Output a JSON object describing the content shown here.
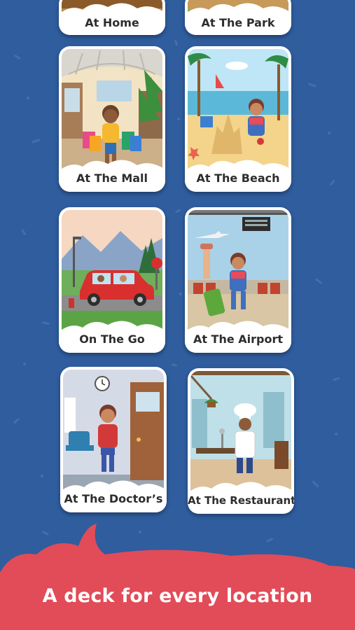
{
  "colors": {
    "background": "#2f5d9e",
    "footer": "#e24b58",
    "card": "#ffffff"
  },
  "decks": [
    {
      "label": "At Home"
    },
    {
      "label": "At The Park"
    },
    {
      "label": "At The Mall"
    },
    {
      "label": "At The Beach"
    },
    {
      "label": "On The Go"
    },
    {
      "label": "At The Airport"
    },
    {
      "label": "At The Doctor’s"
    },
    {
      "label": "At The Restaurant"
    }
  ],
  "footer": {
    "tagline": "A deck for every location"
  }
}
